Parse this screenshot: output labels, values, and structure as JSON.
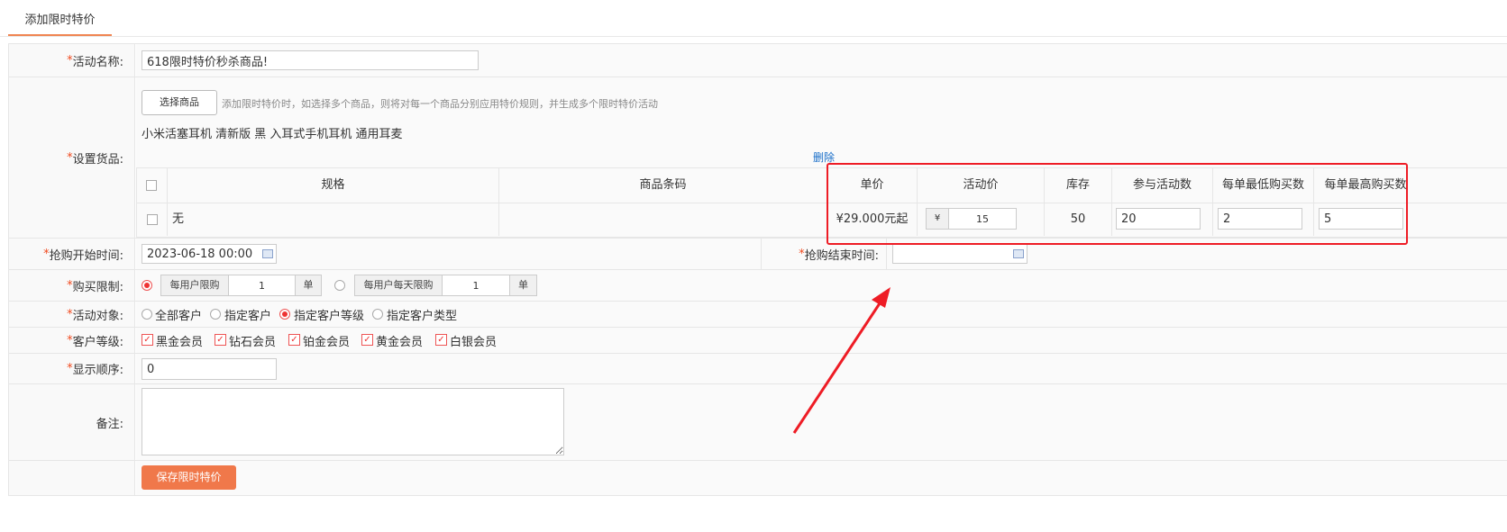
{
  "tab": {
    "label": "添加限时特价"
  },
  "fields": {
    "required_mark": "*",
    "activity_name": {
      "label": "活动名称:",
      "value": "618限时特价秒杀商品!"
    },
    "goods": {
      "label": "设置货品:",
      "select_button": "选择商品",
      "hint": "添加限时特价时，如选择多个商品，则将对每一个商品分别应用特价规则，并生成多个限时特价活动",
      "product_name": "小米活塞耳机 清新版 黑 入耳式手机耳机 通用耳麦",
      "delete_link": "删除",
      "columns": [
        "规格",
        "商品条码",
        "单价",
        "活动价",
        "库存",
        "参与活动数",
        "每单最低购买数",
        "每单最高购买数"
      ],
      "rows": [
        {
          "spec": "无",
          "barcode": "",
          "unit_price": "¥29.000元起",
          "currency": "¥",
          "activity_price": "15",
          "stock": "50",
          "participate": "20",
          "min_per_order": "2",
          "max_per_order": "5"
        }
      ]
    },
    "start_time": {
      "label": "抢购开始时间:",
      "value": "2023-06-18 00:00"
    },
    "end_time": {
      "label": "抢购结束时间:",
      "value": ""
    },
    "purchase_limit": {
      "label": "购买限制:",
      "per_user_label": "每用户限购",
      "per_user_value": "1",
      "per_user_unit": "单",
      "per_user_day_label": "每用户每天限购",
      "per_user_day_value": "1",
      "per_user_day_unit": "单",
      "selected": "per_user"
    },
    "target": {
      "label": "活动对象:",
      "options": [
        "全部客户",
        "指定客户",
        "指定客户等级",
        "指定客户类型"
      ],
      "selected": "指定客户等级"
    },
    "customer_level": {
      "label": "客户等级:",
      "options": [
        "黑金会员",
        "钻石会员",
        "铂金会员",
        "黄金会员",
        "白银会员"
      ]
    },
    "display_order": {
      "label": "显示顺序:",
      "value": "0"
    },
    "remark": {
      "label": "备注:",
      "value": ""
    }
  },
  "save_button": "保存限时特价",
  "colors": {
    "accent": "#f0784a",
    "highlight_box": "#ee1c25",
    "link": "#1a6fc9"
  }
}
